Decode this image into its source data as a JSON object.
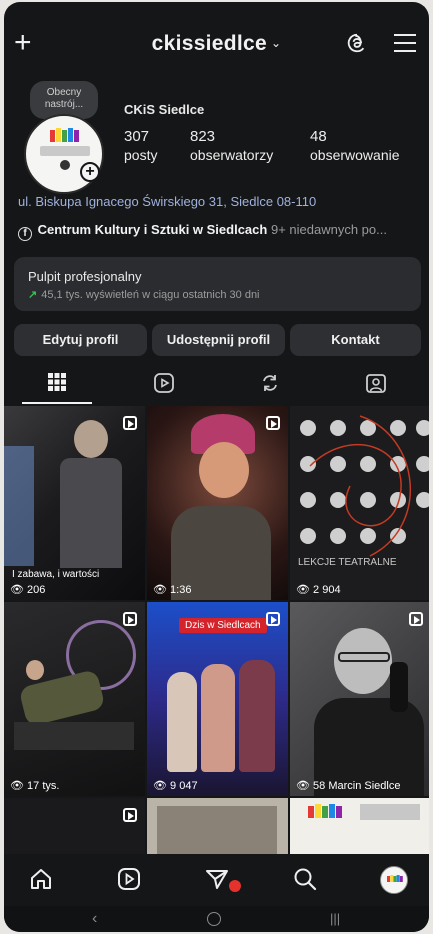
{
  "header": {
    "username": "ckissiedlce",
    "chevron": "⌄"
  },
  "profile": {
    "note": [
      "Obecny",
      "nastrój..."
    ],
    "display_name": "CKiS Siedlce",
    "stats": [
      {
        "value": "307",
        "label": "posty"
      },
      {
        "value": "823",
        "label": "obserwatorzy"
      },
      {
        "value": "48",
        "label": "obserwowanie"
      }
    ],
    "location": "ul. Biskupa Ignacego Świrskiego 31, Siedlce 08-110",
    "page_name": "Centrum Kultury i Sztuki w Siedlcach",
    "page_suffix": "9+ niedawnych po..."
  },
  "dashboard": {
    "title": "Pulpit profesjonalny",
    "subtitle": "45,1 tys. wyświetleń w ciągu ostatnich 30 dni"
  },
  "buttons": {
    "edit": "Edytuj profil",
    "share": "Udostępnij profil",
    "contact": "Kontakt"
  },
  "icons": {
    "create": "plus-icon",
    "threads": "threads-icon",
    "menu": "hamburger-menu-icon",
    "grid_tab": "grid-icon",
    "reels_tab": "reels-icon",
    "reposts_tab": "repost-icon",
    "tagged_tab": "tagged-icon"
  },
  "grid": {
    "posts": [
      {
        "views": "206",
        "caption": "I zabawa, i wartości"
      },
      {
        "views": "1:36",
        "caption": ""
      },
      {
        "views": "2 904",
        "caption": "LEKCJE TEATRALNE"
      },
      {
        "views": "17 tys.",
        "caption": ""
      },
      {
        "views": "9 047",
        "caption": "",
        "tag": "Dzis w Siedlcach"
      },
      {
        "views": "58",
        "caption": "Marcin Siedlce"
      }
    ]
  },
  "bottomnav": {
    "items": [
      "home-icon",
      "reels-icon",
      "send-icon",
      "search-icon",
      "profile-icon"
    ]
  },
  "colors": {
    "background": "#151618",
    "location_link": "#9fb1dd",
    "growth_arrow": "#35c04f",
    "notification": "#e5322c"
  }
}
